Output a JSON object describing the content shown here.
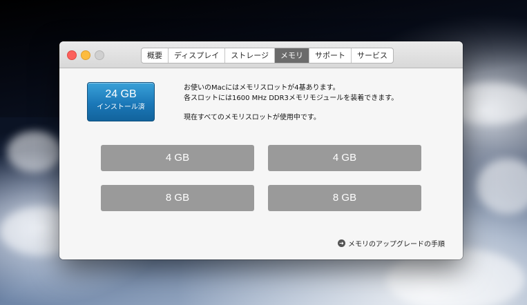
{
  "tabs": [
    {
      "label": "概要"
    },
    {
      "label": "ディスプレイ"
    },
    {
      "label": "ストレージ"
    },
    {
      "label": "メモリ"
    },
    {
      "label": "サポート"
    },
    {
      "label": "サービス"
    }
  ],
  "active_tab": "メモリ",
  "memory": {
    "total": "24 GB",
    "installed_label": "インストール済"
  },
  "info": {
    "line1": "お使いのMacにはメモリスロットが4基あります。",
    "line2": "各スロットには1600 MHz DDR3メモリモジュールを装着できます。",
    "line3": "現在すべてのメモリスロットが使用中です。"
  },
  "slots": [
    {
      "size": "4 GB"
    },
    {
      "size": "4 GB"
    },
    {
      "size": "8 GB"
    },
    {
      "size": "8 GB"
    }
  ],
  "upgrade_link": "メモリのアップグレードの手順",
  "icons": {
    "upgrade": "arrow-right-circle-icon"
  },
  "colors": {
    "memory_badge": "#1b78b8",
    "slot": "#9a9a9a",
    "active_tab": "#6b6b6b"
  }
}
